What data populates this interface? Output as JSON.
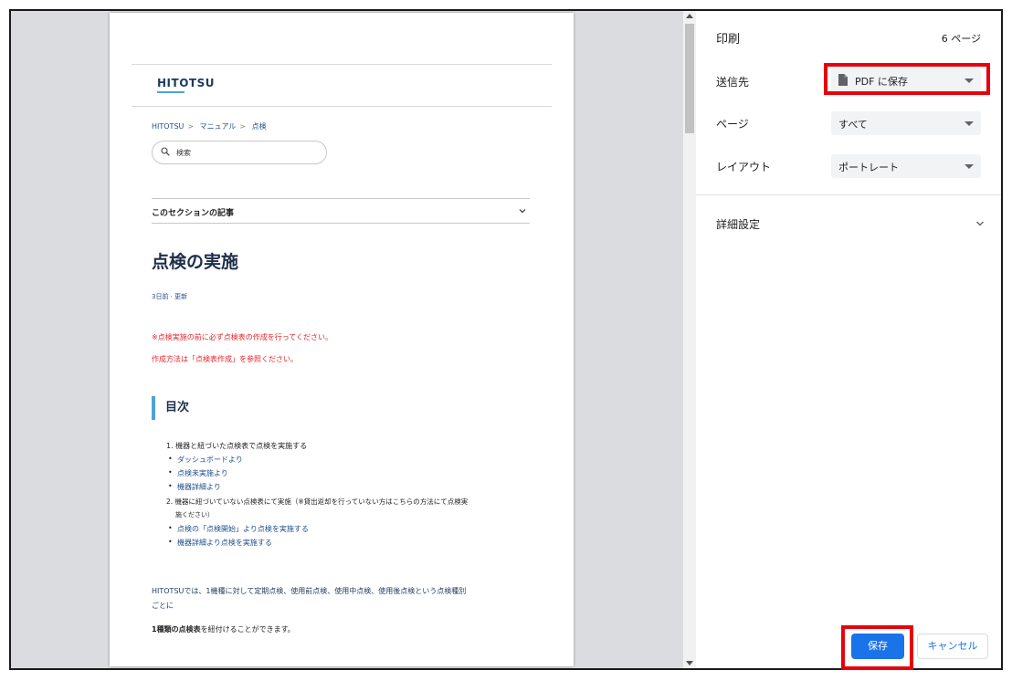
{
  "preview": {
    "logo": "HITOTSU",
    "breadcrumb": [
      "HITOTSU",
      "マニュアル",
      "点検"
    ],
    "breadcrumb_sep": ">",
    "search_placeholder": "検索",
    "section_title": "このセクションの記事",
    "article_title": "点検の実施",
    "meta": "3日前 · 更新",
    "warning_1": "※点検実施の前に必ず点検表の作成を行ってください。",
    "warning_2": "作成方法は「点検表作成」を参照ください。",
    "toc_heading": "目次",
    "toc": {
      "item1": "1. 機器と紐づいた点検表で点検を実施する",
      "item1_sub": [
        "ダッシュボードより",
        "点検未実施より",
        "機器詳細より"
      ],
      "item2_line1": "2. 機器に紐づいていない点検表にて実施（※貸出返却を行っていない方はこちらの方法にて点検実",
      "item2_line2": "施ください）",
      "item2_sub": [
        "点検の「点検開始」より点検を実施する",
        "機器詳細より点検を実施する"
      ]
    },
    "para_line1": "HITOTSUでは、1機種に対して定期点検、使用前点検、使用中点検、使用後点検という点検種別",
    "para_line2": "ごとに",
    "para2_bold": "1種類の点検表",
    "para2_rest": "を紐付けることができます。"
  },
  "panel": {
    "title": "印刷",
    "page_count": "6 ページ",
    "destination_label": "送信先",
    "destination_value": "PDF に保存",
    "pages_label": "ページ",
    "pages_value": "すべて",
    "layout_label": "レイアウト",
    "layout_value": "ポートレート",
    "advanced_label": "詳細設定",
    "save_label": "保存",
    "cancel_label": "キャンセル"
  },
  "colors": {
    "accent": "#1a73e8",
    "highlight": "#e8000b",
    "warning_text": "#e8252b",
    "link": "#1f4e8c"
  }
}
